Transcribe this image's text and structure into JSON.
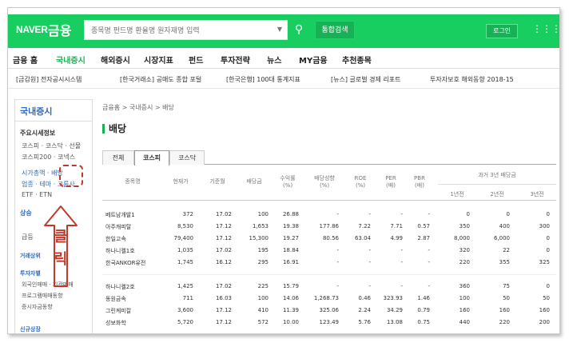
{
  "header": {
    "logo": "NAVER",
    "service": "금융",
    "search_placeholder": "종목명 펀드명 환율명 원자재명 입력",
    "search_submit": "통합검색",
    "login": "로그인"
  },
  "nav": [
    "금융 홈",
    "국내증시",
    "해외증시",
    "시장지표",
    "펀드",
    "투자전략",
    "뉴스",
    "MY금융",
    "추천종목"
  ],
  "ticker": [
    "[금감원] 전자공시시스템",
    "[한국거래소] 공매도 종합 포털",
    "[한국은행] 100대 통계지표",
    "[뉴스] 글로벌 경제 리포트",
    "투자자보호 해외동향 2018-15"
  ],
  "sidebar": {
    "title": "국내증시",
    "section_main": "주요시세정보",
    "items": [
      "코스피 · 코스닥 · 선물",
      "코스피200 · 코넥스",
      "시가총액 · 배당",
      "업종 · 테마 · 그룹사",
      "ETF · ETN"
    ],
    "sections": [
      "상승",
      "급등",
      "거래상위",
      "투자자별",
      "외국인매매 · 기관매매",
      "프로그램매매동향",
      "증시자금동향",
      "신규상장"
    ]
  },
  "breadcrumb": "금융홈 > 국내증시 > 배당",
  "page_title": "배당",
  "tabs": [
    "전체",
    "코스피",
    "코스닥"
  ],
  "table": {
    "headers": [
      "종목명",
      "현재가",
      "기준월",
      "배당금",
      "수익률\n(%)",
      "배당성향\n(%)",
      "ROE\n(%)",
      "PER\n(배)",
      "PBR\n(배)",
      "과거 3년 배당금"
    ],
    "sub_headers": [
      "1년전",
      "2년전",
      "3년전"
    ],
    "rows": [
      [
        "베트남개발1",
        "372",
        "17.02",
        "100",
        "26.88",
        "-",
        "-",
        "-",
        "-",
        "0",
        "0",
        "0"
      ],
      [
        "아주캐피탈",
        "8,530",
        "17.12",
        "1,653",
        "19.38",
        "177.86",
        "7.22",
        "7.71",
        "0.57",
        "350",
        "400",
        "300"
      ],
      [
        "한일고속",
        "79,400",
        "17.12",
        "15,300",
        "19.27",
        "80.56",
        "63.04",
        "4.99",
        "2.87",
        "8,000",
        "6,000",
        "0"
      ],
      [
        "하나니켈1호",
        "1,035",
        "17.02",
        "195",
        "18.84",
        "-",
        "-",
        "-",
        "-",
        "320",
        "22",
        "0"
      ],
      [
        "한국ANKOR유전",
        "1,745",
        "16.12",
        "295",
        "16.91",
        "-",
        "-",
        "-",
        "-",
        "220",
        "355",
        "325"
      ],
      [
        "하나니켈2호",
        "1,425",
        "17.02",
        "225",
        "15.79",
        "-",
        "-",
        "-",
        "-",
        "360",
        "75",
        "0"
      ],
      [
        "동원금속",
        "711",
        "16.03",
        "100",
        "14.06",
        "1,268.73",
        "0.46",
        "323.93",
        "1.46",
        "100",
        "50",
        "50"
      ],
      [
        "그린케미칼",
        "3,600",
        "17.12",
        "410",
        "11.39",
        "325.06",
        "2.24",
        "34.29",
        "0.79",
        "160",
        "160",
        "160"
      ],
      [
        "성보화학",
        "5,720",
        "17.12",
        "572",
        "10.00",
        "123.49",
        "5.76",
        "13.08",
        "0.75",
        "440",
        "220",
        "200"
      ]
    ]
  },
  "annotation": {
    "line1": "클",
    "line2": "릭",
    "color": "#c0392b"
  },
  "colors": {
    "brand": "#19ce60",
    "active_nav": "#17b255",
    "sidebar_title": "#2b6ac5"
  }
}
